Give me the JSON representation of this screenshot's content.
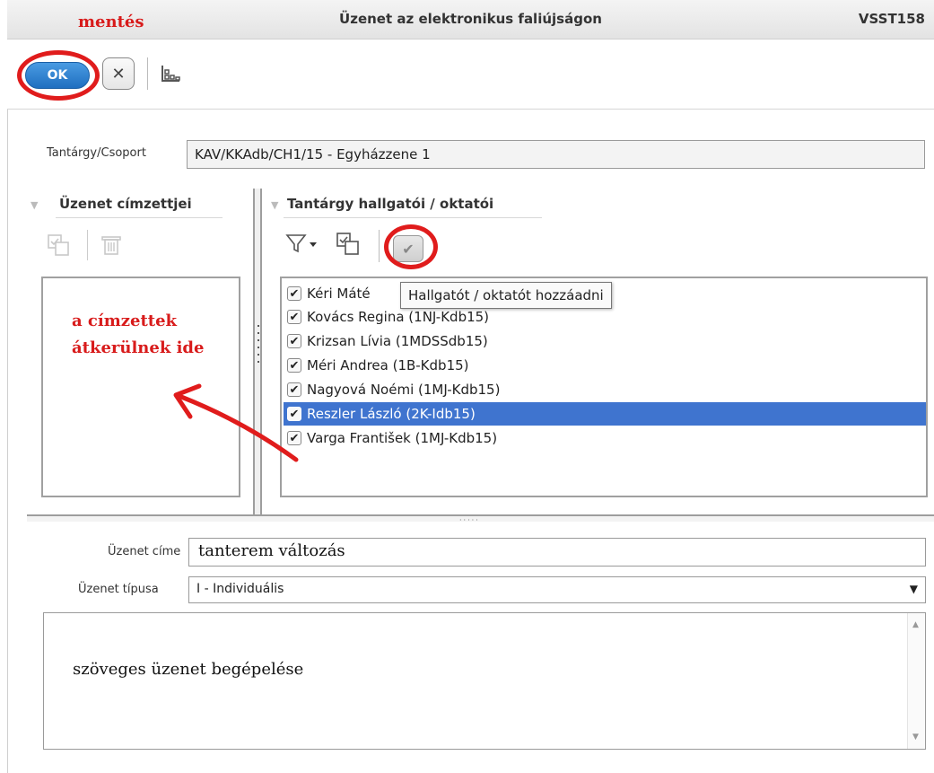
{
  "window": {
    "title": "Üzenet az elektronikus faliújságon",
    "code": "VSST158"
  },
  "toolbar": {
    "ok_label": "OK",
    "cancel_symbol": "✕"
  },
  "annotations": {
    "save": "mentés",
    "recipients_move": "a címzettek átkerülnek ide",
    "accent_color": "#e01c1c"
  },
  "subject": {
    "label": "Tantárgy/Csoport",
    "value": "KAV/KKAdb/CH1/15 - Egyházzene 1"
  },
  "left_panel": {
    "header": "Üzenet címzettjei",
    "icons": [
      "add-selected-icon",
      "trash-icon"
    ]
  },
  "right_panel": {
    "header": "Tantárgy hallgatói / oktatói",
    "icons": [
      "filter-icon",
      "add-selected-icon",
      "check-icon"
    ],
    "tooltip": "Hallgatót / oktatót hozzáadni",
    "list": [
      {
        "name": "Kéri Máté",
        "checked": true,
        "selected": false
      },
      {
        "name": "Kovács Regina (1NJ-Kdb15)",
        "checked": true,
        "selected": false
      },
      {
        "name": "Krizsan Lívia (1MDSSdb15)",
        "checked": true,
        "selected": false
      },
      {
        "name": "Méri Andrea (1B-Kdb15)",
        "checked": true,
        "selected": false
      },
      {
        "name": "Nagyová Noémi (1MJ-Kdb15)",
        "checked": true,
        "selected": false
      },
      {
        "name": "Reszler László (2K-Idb15)",
        "checked": true,
        "selected": true
      },
      {
        "name": "Varga František (1MJ-Kdb15)",
        "checked": true,
        "selected": false
      }
    ],
    "selection_color": "#3f74cf"
  },
  "form": {
    "title_label": "Üzenet címe",
    "title_value": "tanterem változás",
    "type_label": "Üzenet típusa",
    "type_value": "I - Individuális",
    "message_text": "szöveges üzenet begépelése"
  }
}
